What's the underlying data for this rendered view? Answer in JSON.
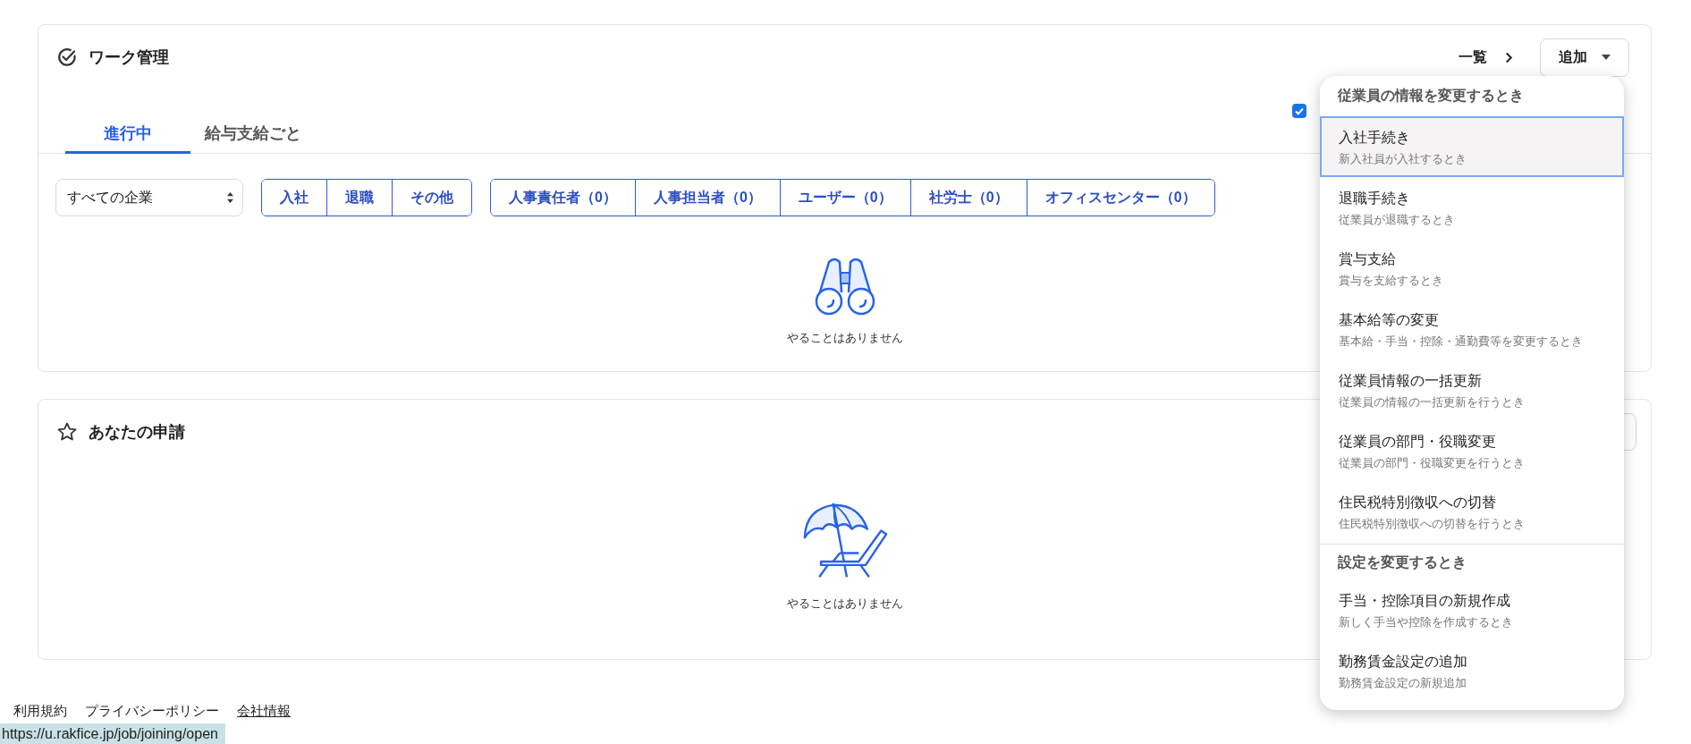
{
  "work_panel": {
    "title": "ワーク管理",
    "list_link": "一覧",
    "add_button": "追加",
    "tabs": [
      {
        "label": "進行中",
        "selected": true
      },
      {
        "label": "給与支給ごと",
        "selected": false
      }
    ],
    "company_select": "すべての企業",
    "type_filters": [
      "入社",
      "退職",
      "その他"
    ],
    "role_filters": [
      "人事責任者（0）",
      "人事担当者（0）",
      "ユーザー（0）",
      "社労士（0）",
      "オフィスセンター（0）"
    ],
    "filter_checkbox": {
      "checked": true
    },
    "empty_message": "やることはありません"
  },
  "requests_panel": {
    "title": "あなたの申請",
    "empty_message": "やることはありません"
  },
  "add_menu": {
    "sections": [
      {
        "heading": "従業員の情報を変更するとき",
        "items": [
          {
            "title": "入社手続き",
            "description": "新入社員が入社するとき",
            "selected": true
          },
          {
            "title": "退職手続き",
            "description": "従業員が退職するとき",
            "selected": false
          },
          {
            "title": "賞与支給",
            "description": "賞与を支給するとき",
            "selected": false
          },
          {
            "title": "基本給等の変更",
            "description": "基本給・手当・控除・通勤費等を変更するとき",
            "selected": false
          },
          {
            "title": "従業員情報の一括更新",
            "description": "従業員の情報の一括更新を行うとき",
            "selected": false
          },
          {
            "title": "従業員の部門・役職変更",
            "description": "従業員の部門・役職変更を行うとき",
            "selected": false
          },
          {
            "title": "住民税特別徴収への切替",
            "description": "住民税特別徴収への切替を行うとき",
            "selected": false
          }
        ]
      },
      {
        "heading": "設定を変更するとき",
        "items": [
          {
            "title": "手当・控除項目の新規作成",
            "description": "新しく手当や控除を作成するとき",
            "selected": false
          },
          {
            "title": "勤務賃金設定の追加",
            "description": "勤務賃金設定の新規追加",
            "selected": false
          }
        ]
      }
    ]
  },
  "footer_links": [
    {
      "label": "利用規約",
      "hovered": false
    },
    {
      "label": "プライバシーポリシー",
      "hovered": false
    },
    {
      "label": "会社情報",
      "hovered": true
    }
  ],
  "status_url": "https://u.rakfice.jp/job/joining/open"
}
